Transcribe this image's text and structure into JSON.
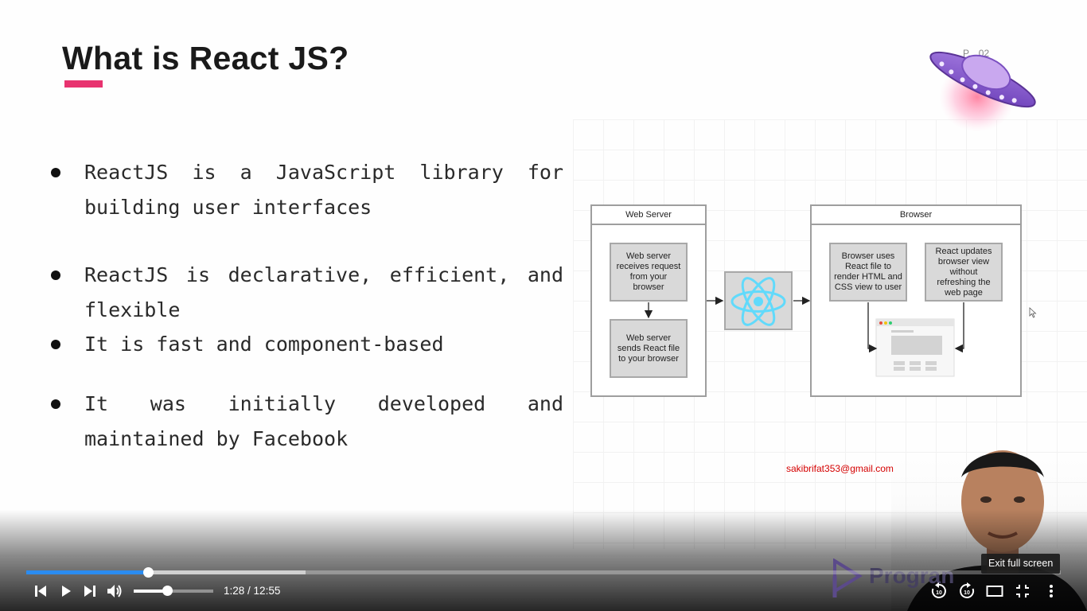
{
  "slide": {
    "title": "What is React JS?",
    "accent_color": "#e8336f",
    "bullets": [
      "ReactJS is a JavaScript library for building user interfaces",
      "ReactJS is declarative, efficient, and flexible",
      "It is  fast and component-based",
      "It was initially developed and maintained by Facebook"
    ],
    "ufo_label": "P... 02",
    "diagram": {
      "web_server": {
        "title": "Web Server",
        "step1": "Web server receives request from your browser",
        "step2": "Web server sends React file to your browser"
      },
      "react_icon": "react-logo-icon",
      "browser": {
        "title": "Browser",
        "step1": "Browser uses React file to render HTML and CSS view to user",
        "step2": "React updates browser view without refreshing the web page"
      }
    },
    "email": "sakibrifat353@gmail.com",
    "brand_text": "Progran"
  },
  "player": {
    "progress_fraction": 0.118,
    "buffered_fraction": 0.27,
    "volume_fraction": 0.42,
    "current_time": "1:28",
    "duration": "12:55",
    "time_separator": " / ",
    "tooltip": "Exit full screen",
    "controls": {
      "previous": "skip-previous-icon",
      "play": "play-icon",
      "next": "skip-next-icon",
      "volume": "volume-icon",
      "rewind": "rewind-10-icon",
      "forward": "forward-10-icon",
      "theater": "theater-mode-icon",
      "fullscreen": "exit-fullscreen-icon",
      "more": "more-vert-icon"
    },
    "progress_color": "#2b8cf0"
  }
}
